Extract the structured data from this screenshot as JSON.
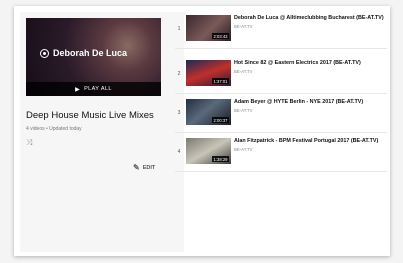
{
  "playlist": {
    "hero_artist": "Deborah De Luca",
    "play_all": "PLAY ALL",
    "title": "Deep House Music Live Mixes",
    "meta": "4 videos • Updated today",
    "edit_label": "EDIT"
  },
  "videos": [
    {
      "index": "1",
      "title": "Deborah De Luca @ Alltimeclubbing Bucharest (BE-AT.TV)",
      "channel": "BE-AT.TV",
      "duration": "2:03:43"
    },
    {
      "index": "2",
      "title": "Hot Since 82 @ Eastern Electrics 2017 (BE-AT.TV)",
      "channel": "BE-AT.TV",
      "duration": "1:37:01"
    },
    {
      "index": "3",
      "title": "Adam Beyer @ HYTE Berlin - NYE 2017 (BE-AT.TV)",
      "channel": "BE-AT.TV",
      "duration": "2:00:37"
    },
    {
      "index": "4",
      "title": "Alan Fitzpatrick - BPM Festival Portugal 2017 (BE-AT.TV)",
      "channel": "BE-AT.TV",
      "duration": "1:38:29"
    }
  ],
  "icons": {
    "play": "play-icon",
    "shuffle": "shuffle-icon",
    "edit": "pencil-icon",
    "logo": "channel-logo-icon"
  }
}
